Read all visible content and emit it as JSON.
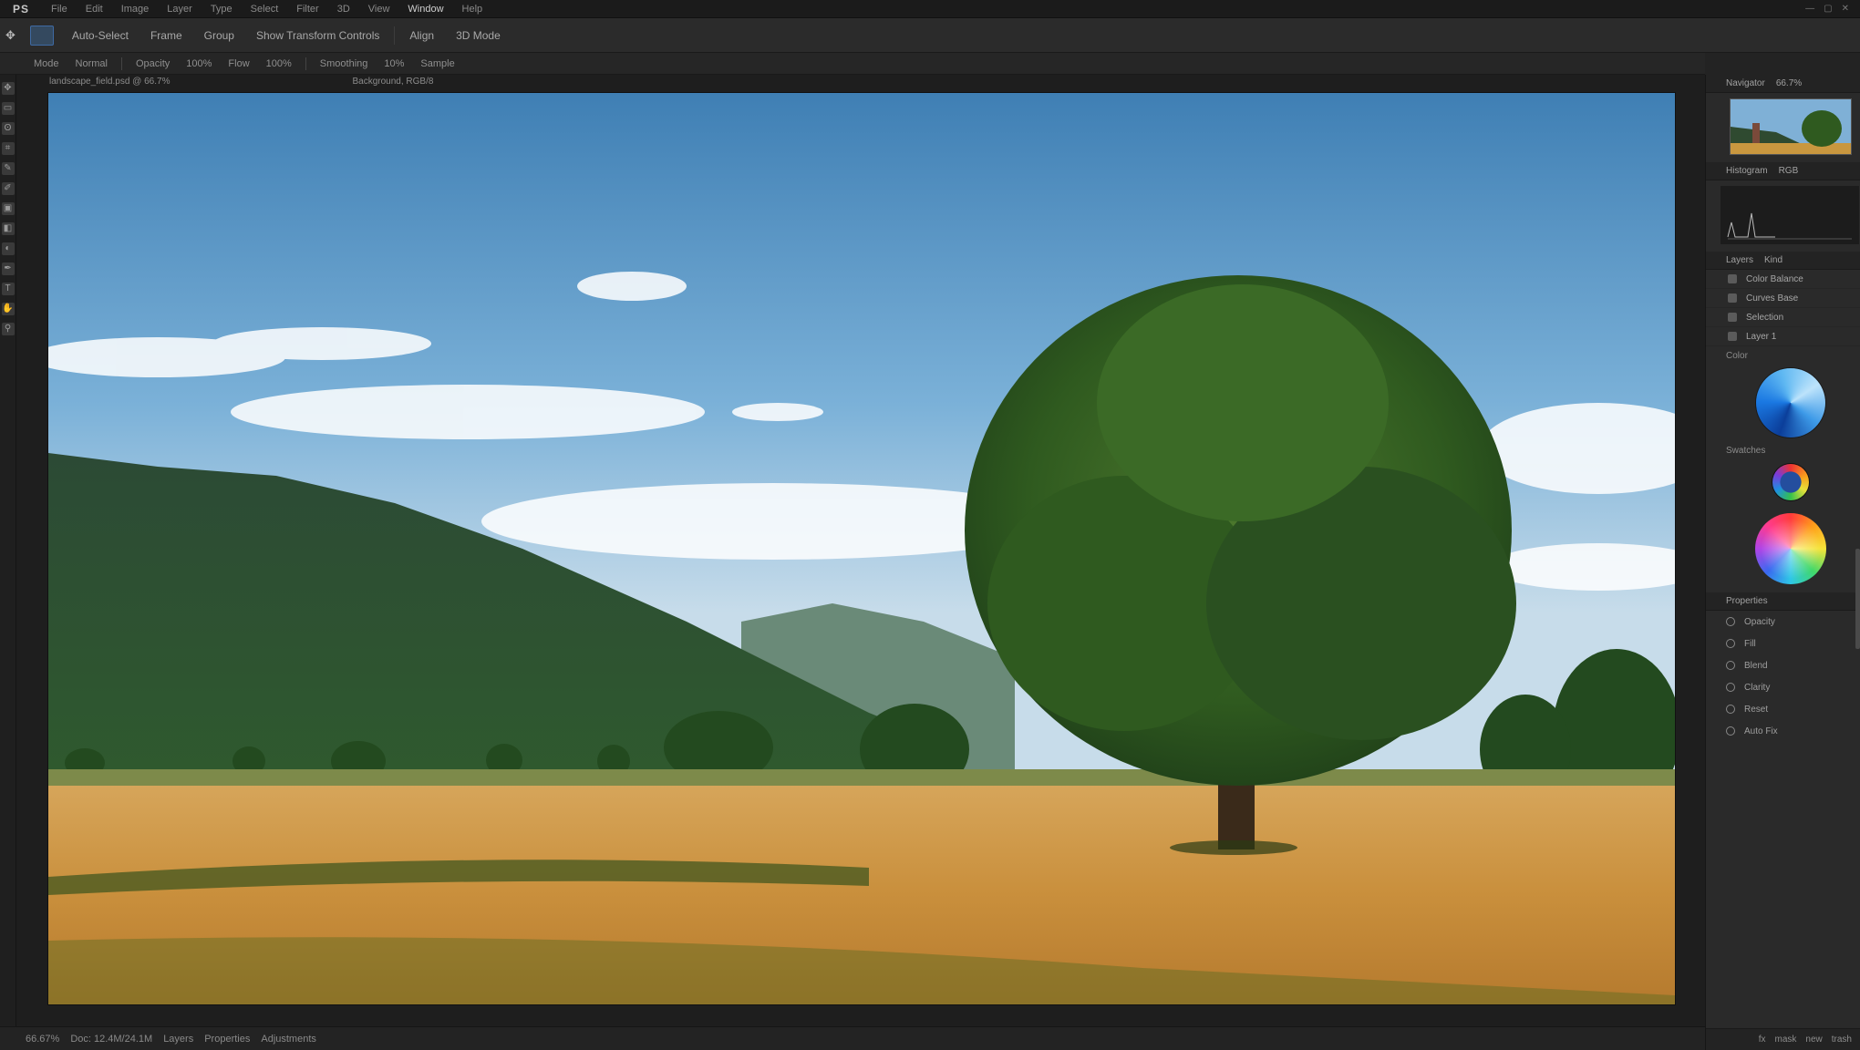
{
  "menubar": {
    "logo": "PS",
    "items": [
      "File",
      "Edit",
      "Image",
      "Layer",
      "Type",
      "Select",
      "Filter",
      "3D",
      "View",
      "Window",
      "Help"
    ],
    "active_index": 9,
    "window_controls": [
      "—",
      "▢",
      "✕"
    ]
  },
  "optionsbar": {
    "items": [
      "Auto-Select",
      "Frame",
      "Group",
      "Show Transform Controls",
      "Align",
      "3D Mode"
    ]
  },
  "subbar": {
    "items": [
      "Mode",
      "Normal",
      "Opacity",
      "100%",
      "Flow",
      "100%",
      "Smoothing",
      "10%",
      "Sample"
    ]
  },
  "document": {
    "tab_primary": "landscape_field.psd @ 66.7%",
    "tab_secondary": "Background, RGB/8"
  },
  "statusbar": {
    "items": [
      "66.67%",
      "Doc: 12.4M/24.1M",
      "Layers",
      "Properties",
      "Adjustments"
    ]
  },
  "rightpanel": {
    "navigator_title": "Navigator",
    "navigator_zoom": "66.7%",
    "histogram_title": "Histogram",
    "histogram_channel": "RGB",
    "layers_title": "Layers",
    "layers_kind": "Kind",
    "layers": [
      "Color Balance",
      "Curves Base",
      "Selection",
      "Layer 1"
    ],
    "color_title": "Color",
    "swatches_title": "Swatches",
    "properties_title": "Properties",
    "properties": [
      "Opacity",
      "Fill",
      "Blend",
      "Clarity",
      "Reset",
      "Auto Fix"
    ],
    "footer_icons": [
      "fx",
      "mask",
      "new",
      "trash"
    ]
  },
  "colors": {
    "accent": "#3f6aa3",
    "chrome_dark": "#1b1b1b",
    "panel": "#2a2a2a"
  }
}
